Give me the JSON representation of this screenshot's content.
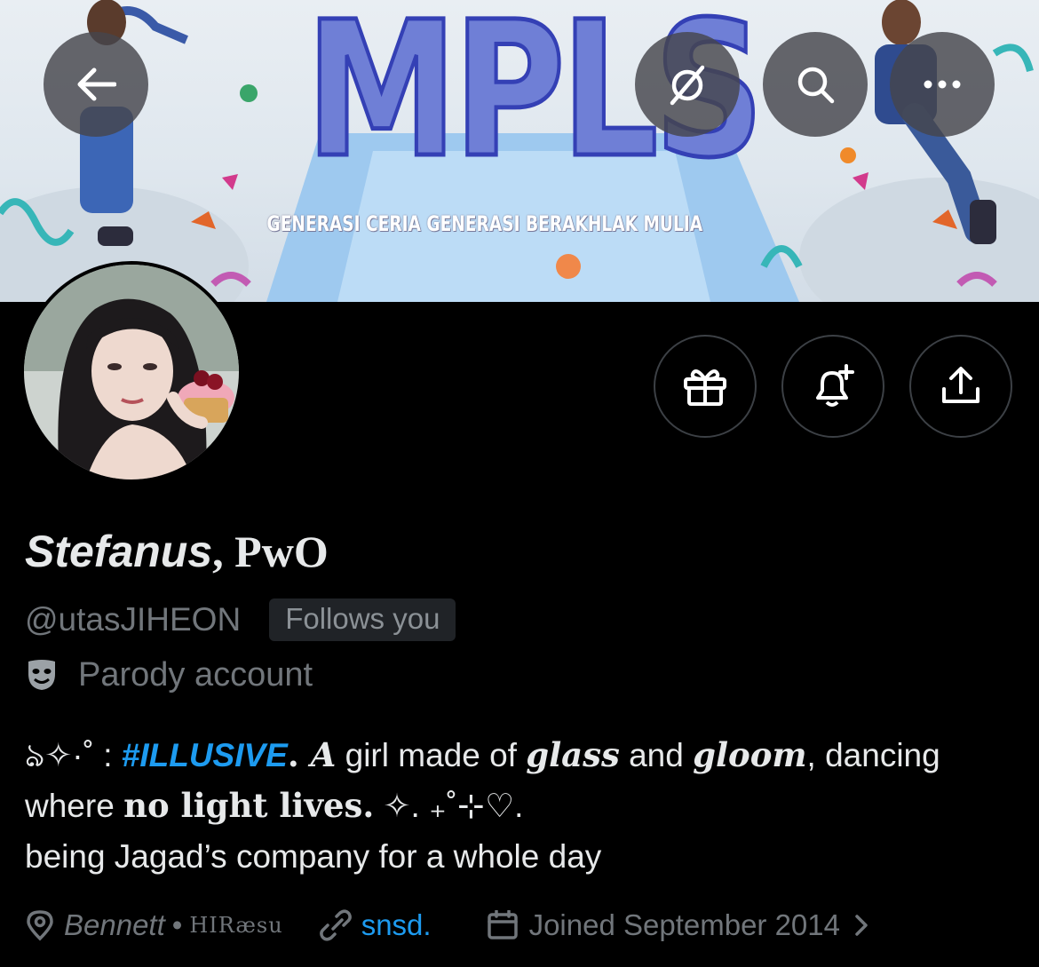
{
  "banner": {
    "headline": "MPLS",
    "tagline": "GENERASI CERIA GENERASI BERAKHLAK MULIA"
  },
  "header": {
    "back_icon": "arrow-left-icon",
    "grok_icon": "slashed-circle-icon",
    "search_icon": "search-icon",
    "more_icon": "more-horizontal-icon"
  },
  "actions": {
    "gift_icon": "gift-icon",
    "notify_icon": "bell-plus-icon",
    "share_icon": "share-icon"
  },
  "profile": {
    "display_name_a": "Stefanus",
    "display_name_b": ", PwO",
    "handle": "@utasJIHEON",
    "follows_you": "Follows you",
    "parody_label": "Parody account",
    "bio": {
      "l1_prefix": "ঌ✧·˚ : ",
      "l1_hashtag": "#ILLUSIVE",
      "l1_dot": ". ",
      "l1_A": "A",
      "l1_girl": " girl made of ",
      "l1_glass": "glass",
      "l1_and": " and ",
      "l1_gloom": "gloom",
      "l1_rest": ", dancing",
      "l2_where": "where ",
      "l2_nolight": "no light lives.",
      "l2_rest": " ✧. ₊˚⊹♡.",
      "l3": "being Jagad’s company for a whole day"
    },
    "location_name": "Bennett",
    "location_sep": "•",
    "location_extra": "HIRæsu",
    "link": "snsd.",
    "joined": "Joined September 2014"
  },
  "colors": {
    "accent": "#1d9bf0",
    "muted": "#71767b",
    "text": "#e7e9ea",
    "background": "#000000"
  }
}
